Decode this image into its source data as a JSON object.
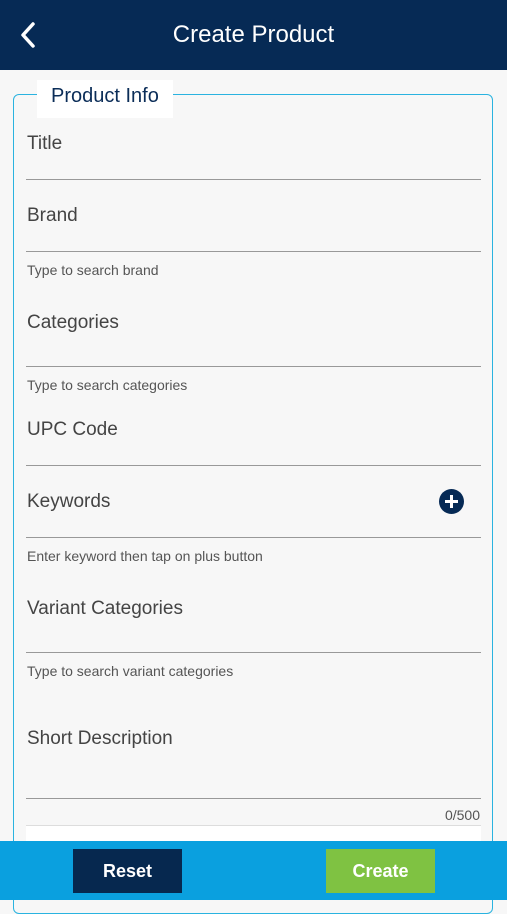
{
  "header": {
    "title": "Create Product"
  },
  "section": {
    "legend": "Product Info"
  },
  "fields": {
    "title": {
      "label": "Title"
    },
    "brand": {
      "label": "Brand",
      "helper": "Type to search brand"
    },
    "categories": {
      "label": "Categories",
      "helper": "Type to search categories"
    },
    "upc": {
      "label": "UPC Code"
    },
    "keywords": {
      "label": "Keywords",
      "helper": "Enter keyword then tap on plus button"
    },
    "variant_categories": {
      "label": "Variant Categories",
      "helper": "Type to search variant categories"
    },
    "short_description": {
      "label": "Short Description",
      "counter": "0/500"
    }
  },
  "footer": {
    "reset_label": "Reset",
    "create_label": "Create"
  },
  "colors": {
    "header": "#062a55",
    "accent": "#2ab3e0",
    "footer": "#0aa0df",
    "create": "#7fc242",
    "reset": "#06284f"
  }
}
